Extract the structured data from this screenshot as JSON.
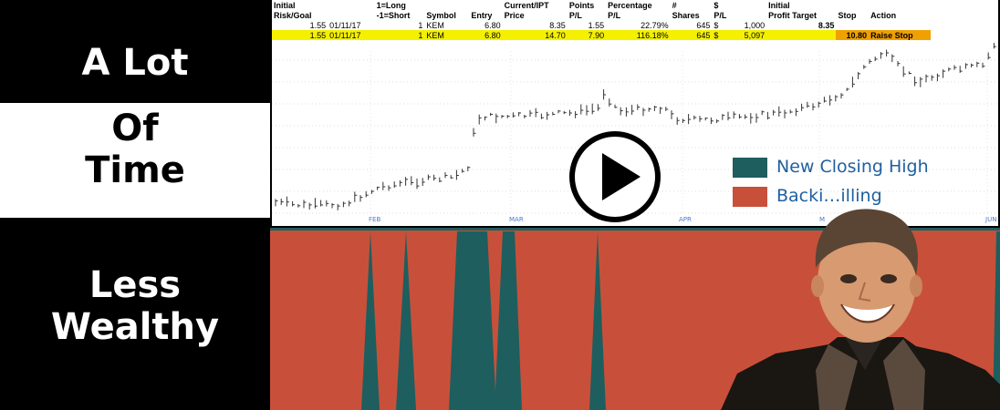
{
  "captions": {
    "top": "A Lot",
    "middle": "Of\nTime",
    "bottom": "Less\nWealthy"
  },
  "trade_table": {
    "header_row1": [
      "Initial",
      "1=Long",
      "",
      "",
      "Current/IPT",
      "Points",
      "Percentage",
      "#",
      "$",
      "Initial",
      "",
      ""
    ],
    "header_row2": [
      "Risk/Goal",
      "-1=Short",
      "Symbol",
      "Entry",
      "Price",
      "P/L",
      "P/L",
      "Shares",
      "P/L",
      "Profit Target",
      "Stop",
      "Action"
    ],
    "rows": [
      {
        "risk": "1.55",
        "date": "01/11/17",
        "dir": "1",
        "symbol": "KEM",
        "entry": "6.80",
        "price": "8.35",
        "points": "1.55",
        "pct": "22.79%",
        "shares": "645",
        "cur": "$",
        "pl": "1,000",
        "target": "8.35",
        "stop": "",
        "action": ""
      },
      {
        "risk": "1.55",
        "date": "01/11/17",
        "dir": "1",
        "symbol": "KEM",
        "entry": "6.80",
        "price": "14.70",
        "points": "7.90",
        "pct": "116.18%",
        "shares": "645",
        "cur": "$",
        "pl": "5,097",
        "target": "",
        "stop": "10.80",
        "action": "Raise Stop"
      }
    ]
  },
  "months": [
    "FEB",
    "MAR",
    "APR",
    "M",
    "JUN"
  ],
  "legend": [
    {
      "label": "New Closing High",
      "color": "#1e5e5e"
    },
    {
      "label": "Backi…illing",
      "color": "#c8503a"
    }
  ],
  "colors": {
    "teal": "#1e5e5e",
    "red": "#c8503a",
    "yellow_row": "#f4f000",
    "orange_stop": "#f0a000",
    "month_label": "#4a7ad0"
  },
  "icons": {
    "play": "play-button-icon",
    "presenter": "presenter-photo"
  }
}
